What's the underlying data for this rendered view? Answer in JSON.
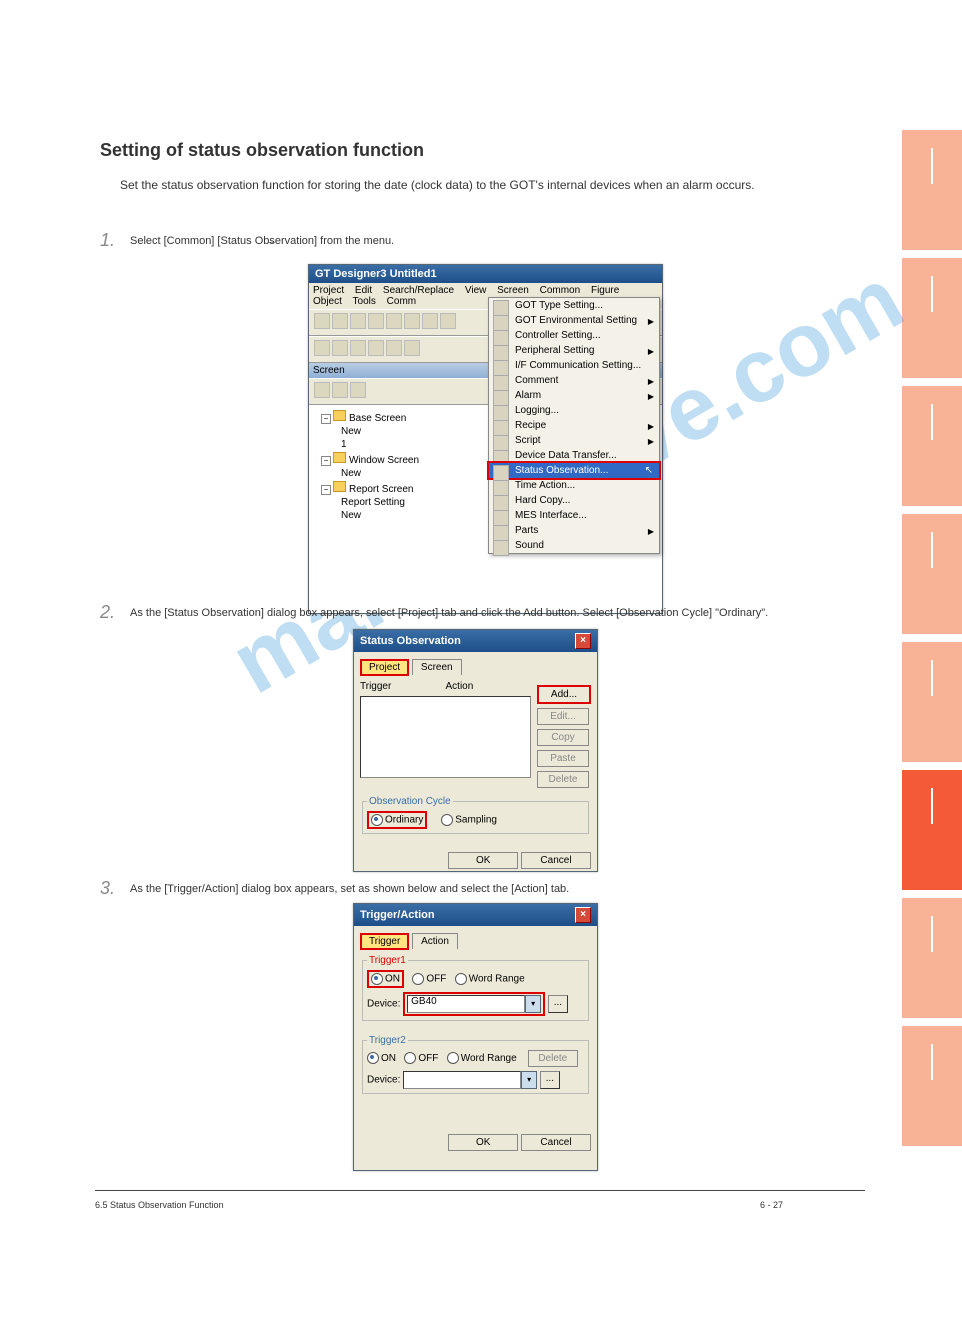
{
  "section": {
    "heading": "Setting of status observation function",
    "intro_text": "Set the status observation function for storing the date (clock data) to the GOT's internal devices when an alarm occurs."
  },
  "steps": {
    "s1_num": "1.",
    "s1_arrow": "→",
    "s1_text": "Select [Common]      [Status Observation] from the menu.",
    "s2_num": "2.",
    "s2_text": "As the [Status Observation] dialog box appears, select [Project] tab and click the  Add  button. Select [Observation Cycle] \"Ordinary\".",
    "s3_num": "3.",
    "s3_text": "As the [Trigger/Action] dialog box appears, set as shown below and select the [Action] tab."
  },
  "gt_designer": {
    "title": "GT Designer3 Untitled1",
    "menus": [
      "Project",
      "Edit",
      "Search/Replace",
      "View",
      "Screen",
      "Common",
      "Figure",
      "Object",
      "Tools",
      "Comm"
    ],
    "dock_title": "Screen",
    "pin": "✕",
    "tree": {
      "base": "Base Screen",
      "new1": "New",
      "one": "1",
      "window": "Window Screen",
      "new2": "New",
      "report": "Report Screen",
      "reportset": "Report Setting",
      "new3": "New"
    }
  },
  "common_menu": {
    "items": [
      "GOT Type Setting...",
      "GOT Environmental Setting",
      "Controller Setting...",
      "Peripheral Setting",
      "I/F Communication Setting...",
      "Comment",
      "Alarm",
      "Logging...",
      "Recipe",
      "Script",
      "Device Data Transfer...",
      "Status Observation...",
      "Time Action...",
      "Hard Copy...",
      "MES Interface...",
      "Parts",
      "Sound"
    ]
  },
  "status_observation": {
    "title": "Status Observation",
    "tab_project": "Project",
    "tab_screen": "Screen",
    "col_trigger": "Trigger",
    "col_action": "Action",
    "btn_add": "Add...",
    "btn_edit": "Edit...",
    "btn_copy": "Copy",
    "btn_paste": "Paste",
    "btn_delete": "Delete",
    "fieldset": "Observation Cycle",
    "radio_ordinary": "Ordinary",
    "radio_sampling": "Sampling",
    "btn_ok": "OK",
    "btn_cancel": "Cancel"
  },
  "trigger_action": {
    "title": "Trigger/Action",
    "tab_trigger": "Trigger",
    "tab_action": "Action",
    "group1": "Trigger1",
    "group2": "Trigger2",
    "on": "ON",
    "off": "OFF",
    "wordrange": "Word Range",
    "device_label": "Device:",
    "device_value": "GB40",
    "btn_delete": "Delete",
    "btn_ok": "OK",
    "btn_cancel": "Cancel"
  },
  "footer": {
    "left": "6.5 Status Observation Function",
    "right": "6 - 27"
  },
  "watermark": "manualshive.com"
}
